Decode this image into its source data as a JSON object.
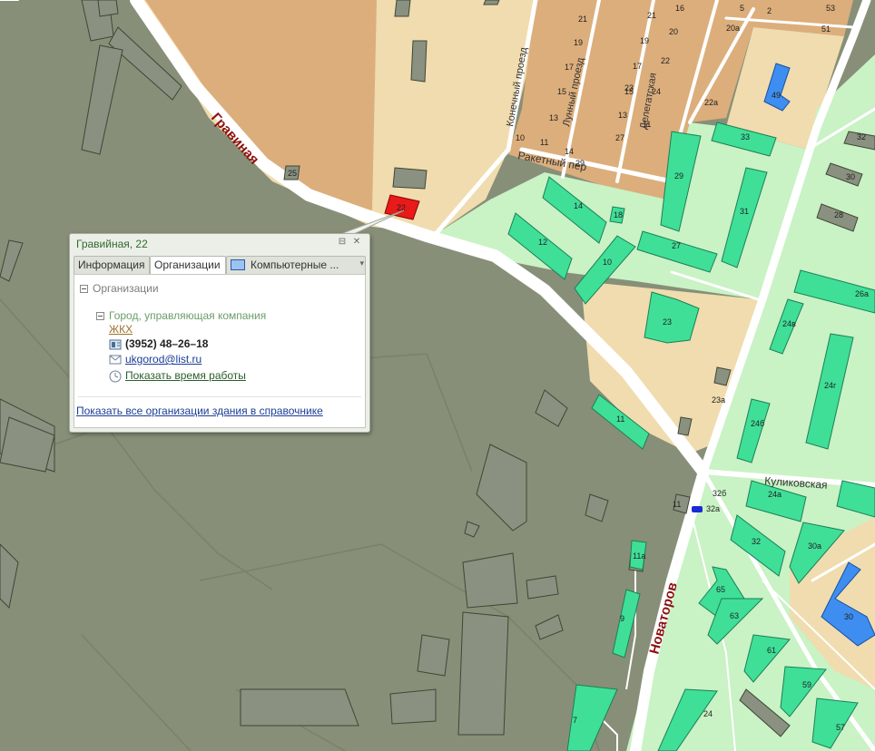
{
  "map": {
    "streets": {
      "gravinaya": "Гравиная",
      "konechny": "Конечный проезд",
      "lunny": "Лунный проезд",
      "delegatskaya": "Делегатская",
      "raketny": "Ракетный пер",
      "kulikovskaya": "Куликовская",
      "novatorov": "Новаторов"
    },
    "house_numbers": [
      "25",
      "22",
      "21",
      "19",
      "17",
      "15",
      "13",
      "10",
      "11",
      "14",
      "29",
      "21",
      "19",
      "17",
      "15",
      "13",
      "11",
      "20",
      "22",
      "24",
      "23",
      "25",
      "27",
      "28",
      "16",
      "5",
      "2",
      "53",
      "51",
      "20а",
      "22а",
      "49",
      "33",
      "32",
      "30",
      "28",
      "29",
      "31",
      "14",
      "18",
      "12",
      "10",
      "27",
      "26а",
      "23",
      "24в",
      "24г",
      "23а",
      "24б",
      "11",
      "11",
      "32б",
      "32а",
      "24а",
      "32",
      "30а",
      "11а",
      "65",
      "63",
      "9",
      "30",
      "61",
      "59",
      "24",
      "57",
      "7"
    ],
    "selected_building": "22"
  },
  "popup": {
    "title": "Гравийная, 22",
    "tabs": [
      "Информация",
      "Организации",
      "Компьютерные ..."
    ],
    "active_tab": 1,
    "section_header": "Организации",
    "org": {
      "name": "Город, управляющая компания",
      "category": "ЖКХ",
      "phone": "(3952) 48–26–18",
      "email": "ukgorod@list.ru",
      "hours_link": "Показать время работы"
    },
    "footer_link": "Показать все организации здания в справочнике"
  },
  "colors": {
    "background": "#878f78",
    "light_green": "#c9f2c5",
    "tan": "#f1ddb0",
    "brown": "#dcae7c",
    "building_green": "#3ee09a",
    "building_blue": "#3f8ef0",
    "selected_red": "#e81a1a",
    "road": "#ffffff"
  }
}
